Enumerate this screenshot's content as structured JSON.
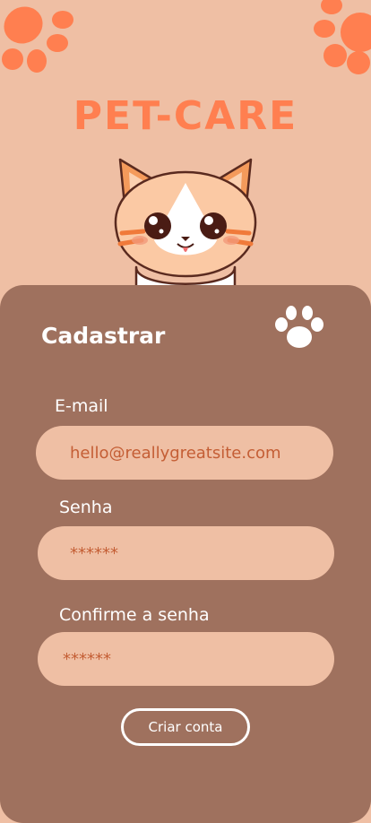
{
  "brand": {
    "title": "PET-CARE"
  },
  "form": {
    "title": "Cadastrar",
    "email_label": "E-mail",
    "email_value": "hello@reallygreatsite.com",
    "password_label": "Senha",
    "password_value": "******",
    "confirm_label": "Confirme a senha",
    "confirm_value": "******",
    "submit_label": "Criar conta"
  },
  "colors": {
    "background": "#efbfa4",
    "accent": "#ff7f50",
    "card": "#9f715e",
    "field_text": "#c45e35"
  },
  "icons": [
    "paw-print-icon",
    "cat-illustration",
    "paw-icon"
  ]
}
